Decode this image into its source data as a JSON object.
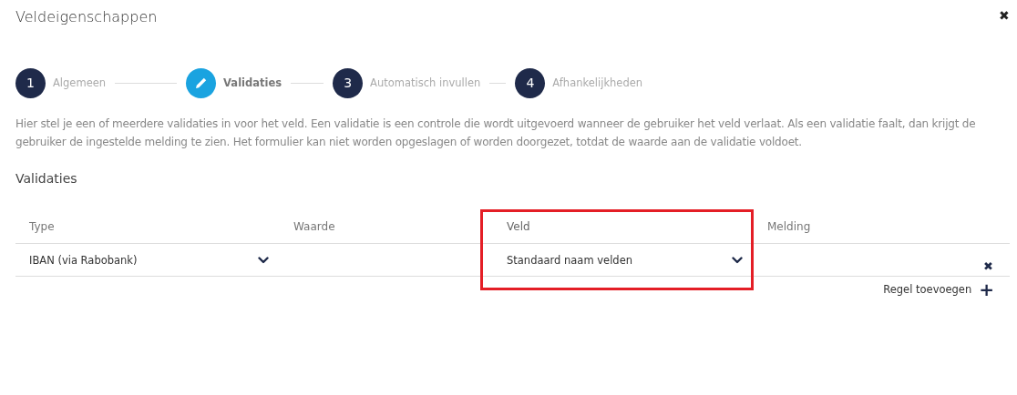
{
  "dialog": {
    "title": "Veldeigenschappen",
    "close": "✖"
  },
  "steps": [
    {
      "number": "1",
      "label": "Algemeen",
      "selected": false
    },
    {
      "label": "Validaties",
      "selected": true
    },
    {
      "number": "3",
      "label": "Automatisch invullen",
      "selected": false
    },
    {
      "number": "4",
      "label": "Afhankelijkheden",
      "selected": false
    }
  ],
  "description": "Hier stel je een of meerdere validaties in voor het veld. Een validatie is een controle die wordt uitgevoerd wanneer de gebruiker het veld verlaat. Als een validatie faalt, dan krijgt de gebruiker de ingestelde melding te zien. Het formulier kan niet worden opgeslagen of worden doorgezet, totdat de waarde aan de validatie voldoet.",
  "section_title": "Validaties",
  "table": {
    "columns": [
      {
        "label": "Type",
        "highlighted": false
      },
      {
        "label": "Waarde",
        "highlighted": false
      },
      {
        "label": "Veld",
        "highlighted": true
      },
      {
        "label": "Melding",
        "highlighted": false
      }
    ],
    "rows": [
      {
        "type": "IBAN (via Rabobank)",
        "veld": "Standaard naam velden",
        "delete": "✖"
      }
    ]
  },
  "add_row": "Regel toevoegen",
  "add_icon": "+"
}
